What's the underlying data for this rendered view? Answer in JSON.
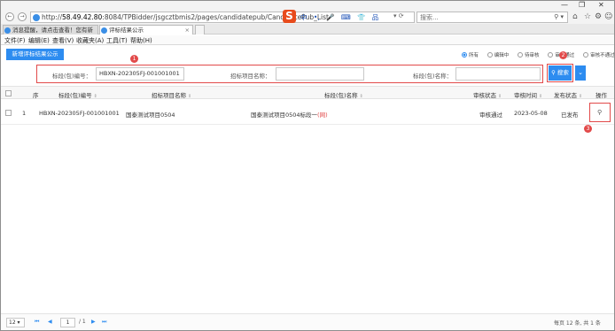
{
  "browser": {
    "url_prefix": "http://",
    "url_host": "58.49.42.80",
    "url_rest": ":8084/TPBidder/jsgcztbmis2/pages/candidatepub/CandidatePub_List",
    "ime_labels": [
      "中",
      "•,",
      "🎤",
      "⌨",
      "👕",
      "品"
    ],
    "search_placeholder": "搜索...",
    "tabs": [
      {
        "label": "消息提醒，请点击查看！您有新"
      },
      {
        "label": "评标结果公示"
      }
    ],
    "menu": [
      "文件(F)",
      "编辑(E)",
      "查看(V)",
      "收藏夹(A)",
      "工具(T)",
      "帮助(H)"
    ]
  },
  "toolbar": {
    "add_button": "新增评标结果公示",
    "status_filters": [
      {
        "label": "所有",
        "checked": true
      },
      {
        "label": "编辑中",
        "checked": false
      },
      {
        "label": "待审核",
        "checked": false
      },
      {
        "label": "审核通过",
        "checked": false
      },
      {
        "label": "审核不通过",
        "checked": false
      }
    ]
  },
  "filter": {
    "code_label": "标段(包)编号：",
    "code_value": "HBXN-202305FJ-001001001",
    "project_label": "招标项目名称：",
    "project_value": "",
    "name_label": "标段(包)名称：",
    "name_value": "",
    "search_button": "搜索",
    "more_button": "⌄"
  },
  "annotations": {
    "step1": "1",
    "step2": "2",
    "step3": "3"
  },
  "table": {
    "headers": {
      "index": "序",
      "code": "标段(包)编号",
      "project": "招标项目名称",
      "name": "标段(包)名称",
      "audit_status": "审核状态",
      "audit_time": "审核时间",
      "publish_status": "发布状态",
      "actions": "操作"
    },
    "rows": [
      {
        "index": "1",
        "code": "HBXN-202305FJ-001001001",
        "project": "国泰测试项目0504",
        "name": "国泰测试项目0504标段一",
        "name_suffix": "(网)",
        "audit_status": "审核通过",
        "audit_time": "2023-05-08",
        "publish_status": "已发布"
      }
    ]
  },
  "pagination": {
    "page_size": "12",
    "current_page": "1",
    "total_pages": "/ 1",
    "summary": "每页 12 条, 共 1 条"
  },
  "colors": {
    "primary": "#2d8cf0",
    "annotation": "#e24a4a"
  }
}
